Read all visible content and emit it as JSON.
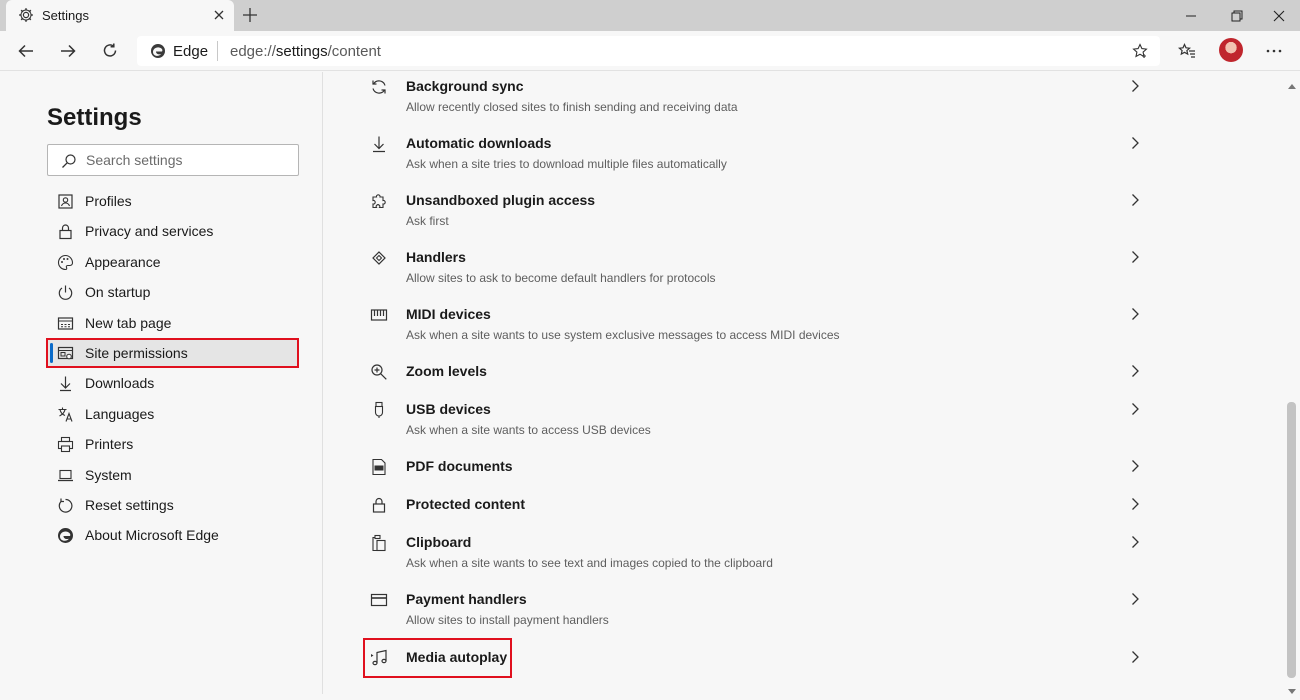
{
  "tab": {
    "title": "Settings"
  },
  "addressbar": {
    "site_label": "Edge",
    "url_prefix": "edge://",
    "url_bold": "settings",
    "url_suffix": "/content"
  },
  "sidebar": {
    "title": "Settings",
    "search_placeholder": "Search settings",
    "items": [
      {
        "label": "Profiles",
        "icon": "profile-icon"
      },
      {
        "label": "Privacy and services",
        "icon": "lock-icon"
      },
      {
        "label": "Appearance",
        "icon": "palette-icon"
      },
      {
        "label": "On startup",
        "icon": "power-icon"
      },
      {
        "label": "New tab page",
        "icon": "newtab-icon"
      },
      {
        "label": "Site permissions",
        "icon": "site-permissions-icon",
        "active": true
      },
      {
        "label": "Downloads",
        "icon": "download-icon"
      },
      {
        "label": "Languages",
        "icon": "languages-icon"
      },
      {
        "label": "Printers",
        "icon": "printer-icon"
      },
      {
        "label": "System",
        "icon": "laptop-icon"
      },
      {
        "label": "Reset settings",
        "icon": "reset-icon"
      },
      {
        "label": "About Microsoft Edge",
        "icon": "edge-logo-icon"
      }
    ]
  },
  "permissions": [
    {
      "title": "Background sync",
      "desc": "Allow recently closed sites to finish sending and receiving data",
      "icon": "sync-icon"
    },
    {
      "title": "Automatic downloads",
      "desc": "Ask when a site tries to download multiple files automatically",
      "icon": "download-icon"
    },
    {
      "title": "Unsandboxed plugin access",
      "desc": "Ask first",
      "icon": "puzzle-icon"
    },
    {
      "title": "Handlers",
      "desc": "Allow sites to ask to become default handlers for protocols",
      "icon": "handlers-icon"
    },
    {
      "title": "MIDI devices",
      "desc": "Ask when a site wants to use system exclusive messages to access MIDI devices",
      "icon": "midi-icon"
    },
    {
      "title": "Zoom levels",
      "desc": "",
      "icon": "zoom-icon"
    },
    {
      "title": "USB devices",
      "desc": "Ask when a site wants to access USB devices",
      "icon": "usb-icon"
    },
    {
      "title": "PDF documents",
      "desc": "",
      "icon": "pdf-icon"
    },
    {
      "title": "Protected content",
      "desc": "",
      "icon": "lock-icon"
    },
    {
      "title": "Clipboard",
      "desc": "Ask when a site wants to see text and images copied to the clipboard",
      "icon": "clipboard-icon"
    },
    {
      "title": "Payment handlers",
      "desc": "Allow sites to install payment handlers",
      "icon": "card-icon"
    },
    {
      "title": "Media autoplay",
      "desc": "",
      "icon": "media-autoplay-icon"
    }
  ],
  "colors": {
    "accent": "#0a6bc9",
    "highlight": "#e0101e"
  }
}
